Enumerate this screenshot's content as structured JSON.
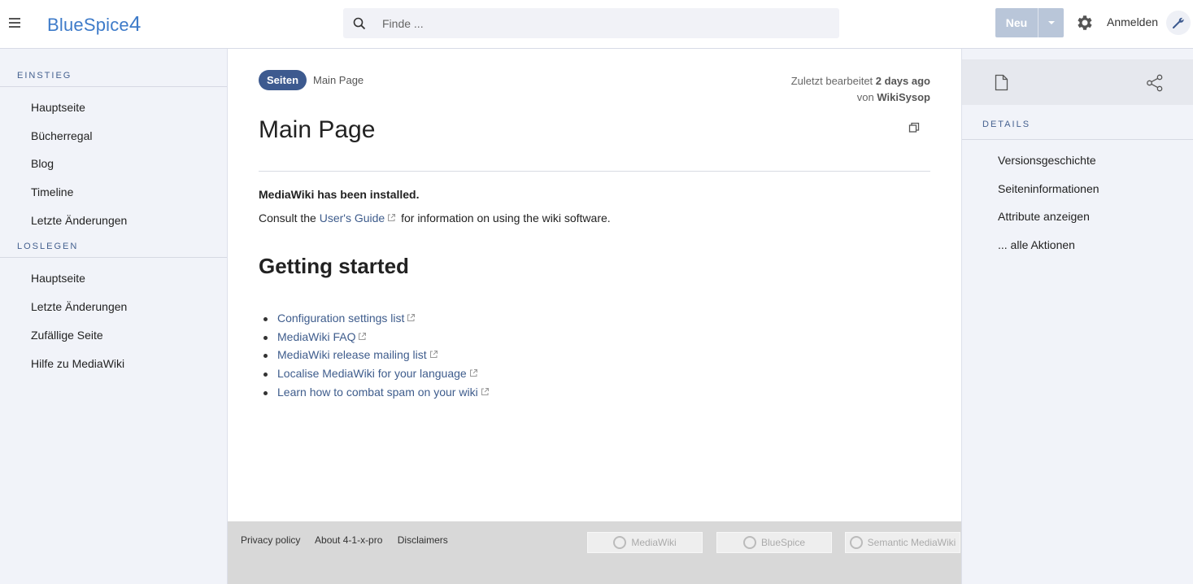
{
  "header": {
    "logo_text": "BlueSpice",
    "logo_version": "4",
    "search_placeholder": "Finde ...",
    "new_button": "Neu",
    "login": "Anmelden"
  },
  "left_sidebar": {
    "sections": [
      {
        "title": "EINSTIEG",
        "items": [
          "Hauptseite",
          "Bücherregal",
          "Blog",
          "Timeline",
          "Letzte Änderungen"
        ]
      },
      {
        "title": "LOSLEGEN",
        "items": [
          "Hauptseite",
          "Letzte Änderungen",
          "Zufällige Seite",
          "Hilfe zu MediaWiki"
        ]
      }
    ]
  },
  "main": {
    "namespace_badge": "Seiten",
    "breadcrumb": "Main Page",
    "last_edited_prefix": "Zuletzt bearbeitet",
    "last_edited_time": "2 days ago",
    "last_edited_by_prefix": "von",
    "last_edited_by": "WikiSysop",
    "title": "Main Page",
    "installed_text": "MediaWiki has been installed.",
    "consult_prefix": "Consult the",
    "users_guide_link": "User's Guide",
    "consult_suffix": "for information on using the wiki software.",
    "getting_started": "Getting started",
    "links": [
      "Configuration settings list",
      "MediaWiki FAQ",
      "MediaWiki release mailing list",
      "Localise MediaWiki for your language",
      "Learn how to combat spam on your wiki"
    ]
  },
  "footer": {
    "links": [
      "Privacy policy",
      "About 4-1-x-pro",
      "Disclaimers"
    ],
    "powered_by": [
      "MediaWiki",
      "BlueSpice",
      "Semantic MediaWiki"
    ]
  },
  "right_sidebar": {
    "section_title": "DETAILS",
    "items": [
      "Versionsgeschichte",
      "Seiteninformationen",
      "Attribute anzeigen",
      "... alle Aktionen"
    ]
  },
  "colors": {
    "accent": "#3d5a8f",
    "link": "#3e5c8c",
    "logo": "#3e7bc9",
    "new_button_bg": "#b9c6d9"
  }
}
